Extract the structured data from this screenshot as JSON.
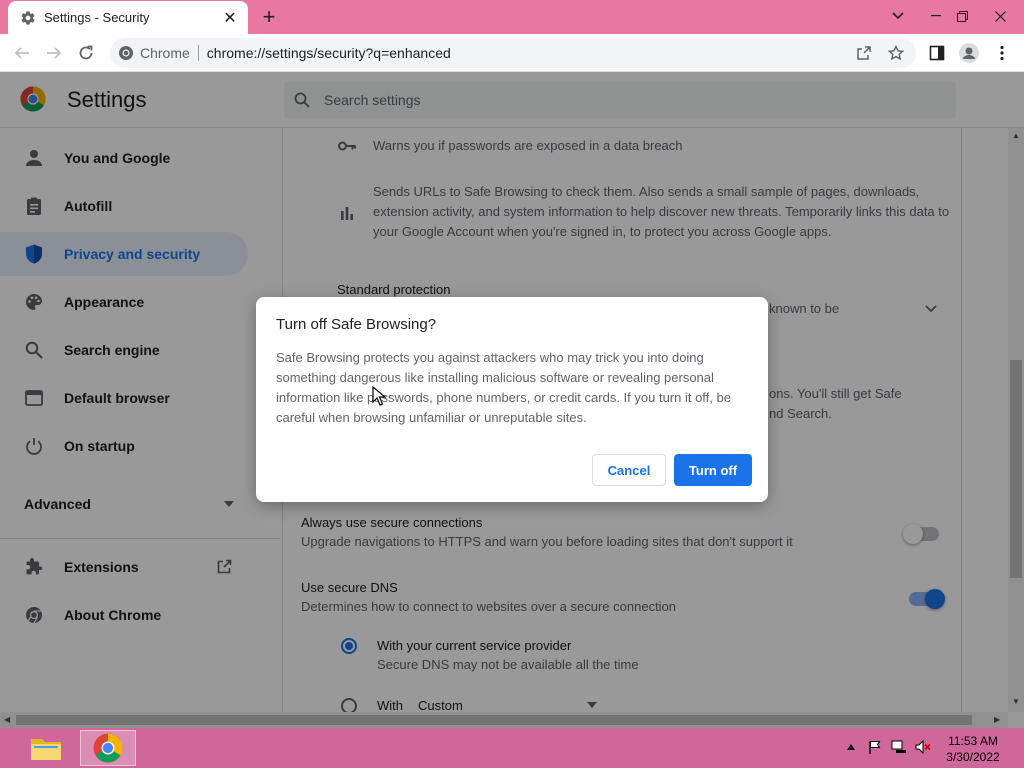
{
  "window": {
    "tab_title": "Settings - Security",
    "close_tab": "✕",
    "new_tab": "+",
    "minimize": "—",
    "restore": "❐",
    "close": "✕",
    "tab_search": "⌄"
  },
  "toolbar": {
    "site_name": "Chrome",
    "url": "chrome://settings/security?q=enhanced"
  },
  "header": {
    "title": "Settings",
    "search_placeholder": "Search settings"
  },
  "sidebar": {
    "items": [
      {
        "label": "You and Google",
        "icon": "person-icon"
      },
      {
        "label": "Autofill",
        "icon": "clipboard-icon"
      },
      {
        "label": "Privacy and security",
        "icon": "shield-icon"
      },
      {
        "label": "Appearance",
        "icon": "palette-icon"
      },
      {
        "label": "Search engine",
        "icon": "magnifier-icon"
      },
      {
        "label": "Default browser",
        "icon": "browser-window-icon"
      },
      {
        "label": "On startup",
        "icon": "power-icon"
      }
    ],
    "advanced_label": "Advanced",
    "extensions_label": "Extensions",
    "about_label": "About Chrome"
  },
  "main": {
    "password_warning": "Warns you if passwords are exposed in a data breach",
    "safe_browsing_desc": "Sends URLs to Safe Browsing to check them. Also sends a small sample of pages, downloads, extension activity, and system information to help discover new threats. Temporarily links this data to your Google Account when you're signed in, to protect you across Google apps.",
    "standard_protection": "Standard protection",
    "standard_partial": "known to be",
    "standard_partial2": "ons. You'll still get Safe",
    "standard_partial3": "nd Search.",
    "secure_connections_title": "Always use secure connections",
    "secure_connections_desc": "Upgrade navigations to HTTPS and warn you before loading sites that don't support it",
    "secure_dns_title": "Use secure DNS",
    "secure_dns_desc": "Determines how to connect to websites over a secure connection",
    "provider_option": "With your current service provider",
    "provider_desc": "Secure DNS may not be available all the time",
    "with_option": "With",
    "custom_value": "Custom"
  },
  "dialog": {
    "title": "Turn off Safe Browsing?",
    "body": "Safe Browsing protects you against attackers who may trick you into doing something dangerous like installing malicious software or revealing personal information like passwords, phone numbers, or credit cards. If you turn it off, be careful when browsing unfamiliar or unreputable sites.",
    "cancel_label": "Cancel",
    "confirm_label": "Turn off"
  },
  "taskbar": {
    "time": "11:53 AM",
    "date": "3/30/2022"
  },
  "colors": {
    "accent": "#1a73e8",
    "titlebar": "#e8789f",
    "taskbar": "#d0679a"
  }
}
